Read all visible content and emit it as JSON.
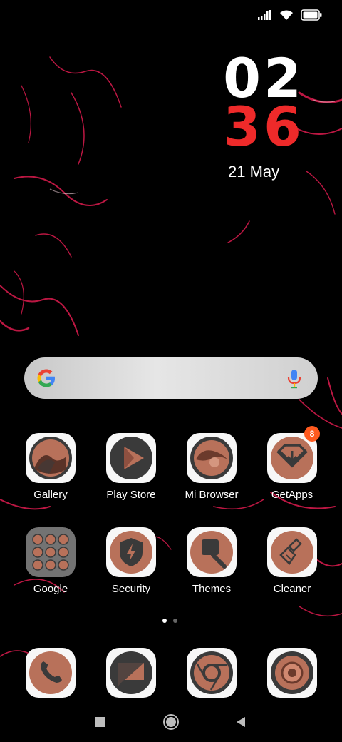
{
  "status_bar": {
    "signal_icon": "signal-icon",
    "wifi_icon": "wifi-icon",
    "battery_icon": "battery-icon"
  },
  "clock": {
    "hour": "02",
    "minute": "36",
    "date": "21 May"
  },
  "search": {
    "logo_icon": "google-g-icon",
    "mic_icon": "mic-icon"
  },
  "apps": [
    {
      "label": "Gallery",
      "icon": "gallery-icon"
    },
    {
      "label": "Play Store",
      "icon": "play-store-icon"
    },
    {
      "label": "Mi Browser",
      "icon": "mi-browser-icon"
    },
    {
      "label": "GetApps",
      "icon": "getapps-icon",
      "badge": "8"
    },
    {
      "label": "Google",
      "icon": "google-folder-icon"
    },
    {
      "label": "Security",
      "icon": "security-icon"
    },
    {
      "label": "Themes",
      "icon": "themes-icon"
    },
    {
      "label": "Cleaner",
      "icon": "cleaner-icon"
    }
  ],
  "dock": [
    {
      "icon": "phone-icon"
    },
    {
      "icon": "messaging-icon"
    },
    {
      "icon": "chrome-icon"
    },
    {
      "icon": "camera-icon"
    }
  ],
  "pages": {
    "count": 2,
    "current": 1
  },
  "nav": {
    "recents_icon": "recents-icon",
    "home_icon": "home-icon",
    "back_icon": "back-icon"
  },
  "colors": {
    "icon_copper": "#b8715a",
    "icon_dark": "#3a3a3a",
    "minute_red": "#ee2a2a",
    "badge_orange": "#ff5a1f"
  }
}
